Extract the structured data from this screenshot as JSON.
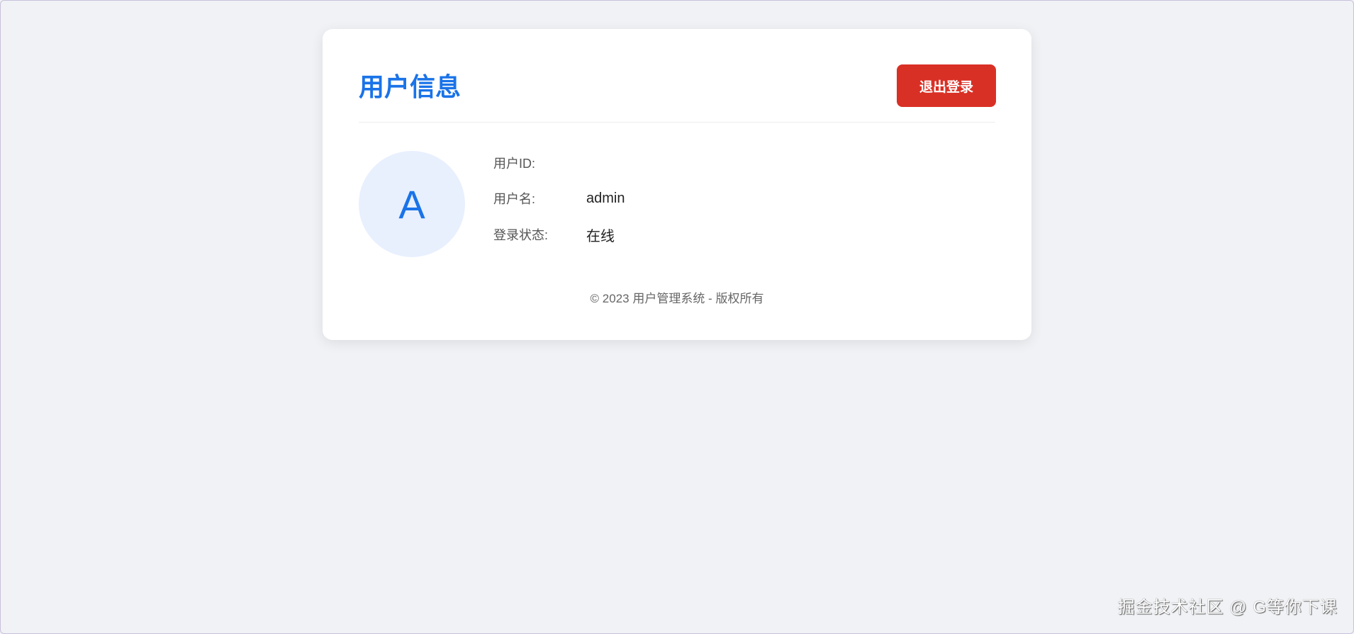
{
  "card": {
    "title": "用户信息",
    "logout_label": "退出登录",
    "avatar_letter": "A",
    "fields": [
      {
        "label": "用户ID:",
        "value": ""
      },
      {
        "label": "用户名:",
        "value": "admin"
      },
      {
        "label": "登录状态:",
        "value": "在线"
      }
    ],
    "footer": "© 2023 用户管理系统 - 版权所有"
  },
  "watermark": "掘金技术社区 @ G等你下课",
  "colors": {
    "accent": "#1a73e8",
    "danger": "#d93025",
    "background": "#f0f2f5"
  }
}
